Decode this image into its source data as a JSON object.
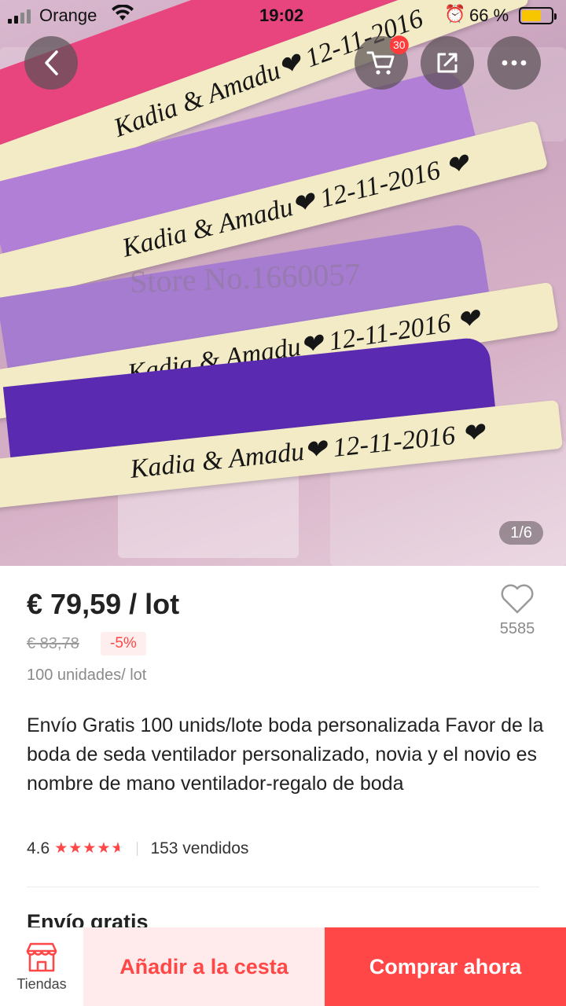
{
  "status_bar": {
    "carrier": "Orange",
    "time": "19:02",
    "battery_percent": "66 %",
    "battery_level": 0.66
  },
  "image": {
    "fan_texts": [
      "Kadia & Amadu❤ 12-11-2016",
      "Kadia & Amadu❤ 12-11-2016 ❤",
      "Kadia & Amadu❤ 12-11-2016 ❤",
      "Kadia & Amadu❤ 12-11-2016 ❤"
    ],
    "watermark": "Store No.1660057",
    "counter": "1/6",
    "fan_colors": [
      "#e8457f",
      "#b27fd6",
      "#a57cd0",
      "#5a2bb0"
    ]
  },
  "header": {
    "cart_badge": "30",
    "icons": [
      "back-arrow-icon",
      "cart-icon",
      "share-icon",
      "more-icon"
    ]
  },
  "product": {
    "price": "€ 79,59 / lot",
    "old_price": "€ 83,78",
    "discount": "-5%",
    "units": "100 unidades/ lot",
    "wishlist_count": "5585",
    "title": "Envío Gratis 100 unids/lote boda personalizada Favor de la boda de seda ventilador personalizado, novia y el novio es nombre de mano ventilador-regalo de boda",
    "rating": "4.6",
    "rating_value": 4.6,
    "sold": "153 vendidos"
  },
  "shipping_heading": "Envío gratis",
  "bottom_bar": {
    "stores_label": "Tiendas",
    "add_to_cart": "Añadir a la cesta",
    "buy_now": "Comprar ahora"
  },
  "colors": {
    "accent": "#ff4747",
    "accent_light": "#ffebeb",
    "star": "#ff4747",
    "battery": "#f7c600"
  }
}
